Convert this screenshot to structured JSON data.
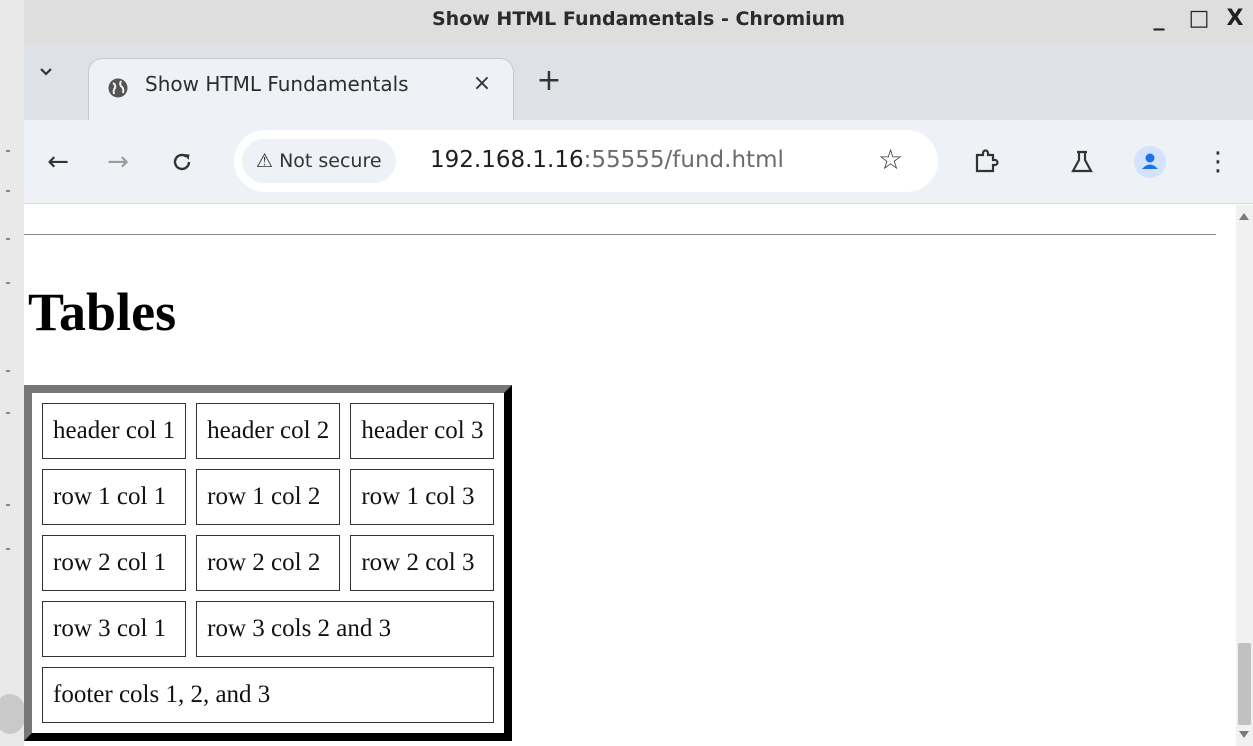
{
  "window": {
    "title": "Show HTML Fundamentals - Chromium",
    "minimize_glyph": "_",
    "maximize_glyph": "□",
    "close_glyph": "X"
  },
  "tabs": {
    "list_glyph": "⌄",
    "active": {
      "title": "Show HTML Fundamentals",
      "icon": "globe-icon",
      "close_glyph": "×"
    },
    "new_tab_glyph": "+"
  },
  "toolbar": {
    "back_glyph": "←",
    "forward_glyph": "→",
    "reload_glyph": "C",
    "security_label": "⚠ Not secure",
    "url_host": "192.168.1.16",
    "url_rest": ":55555/fund.html",
    "star_glyph": "☆",
    "extensions_icon": "puzzle-icon",
    "labs_icon": "flask-icon",
    "profile_icon": "person-icon",
    "menu_glyph": "⋮"
  },
  "page": {
    "heading": "Tables",
    "table": {
      "header": [
        "header col 1",
        "header col 2",
        "header col 3"
      ],
      "rows": [
        [
          "row 1 col 1",
          "row 1 col 2",
          "row 1 col 3"
        ],
        [
          "row 2 col 1",
          "row 2 col 2",
          "row 2 col 3"
        ]
      ],
      "row3": [
        "row 3 col 1",
        "row 3 cols 2 and 3"
      ],
      "footer": "footer cols 1, 2, and 3"
    }
  },
  "colors": {
    "titlebar": "#dedede",
    "tabstrip": "#dee1e6",
    "toolbar": "#eef1f5",
    "profile_accent": "#1a73e8"
  }
}
